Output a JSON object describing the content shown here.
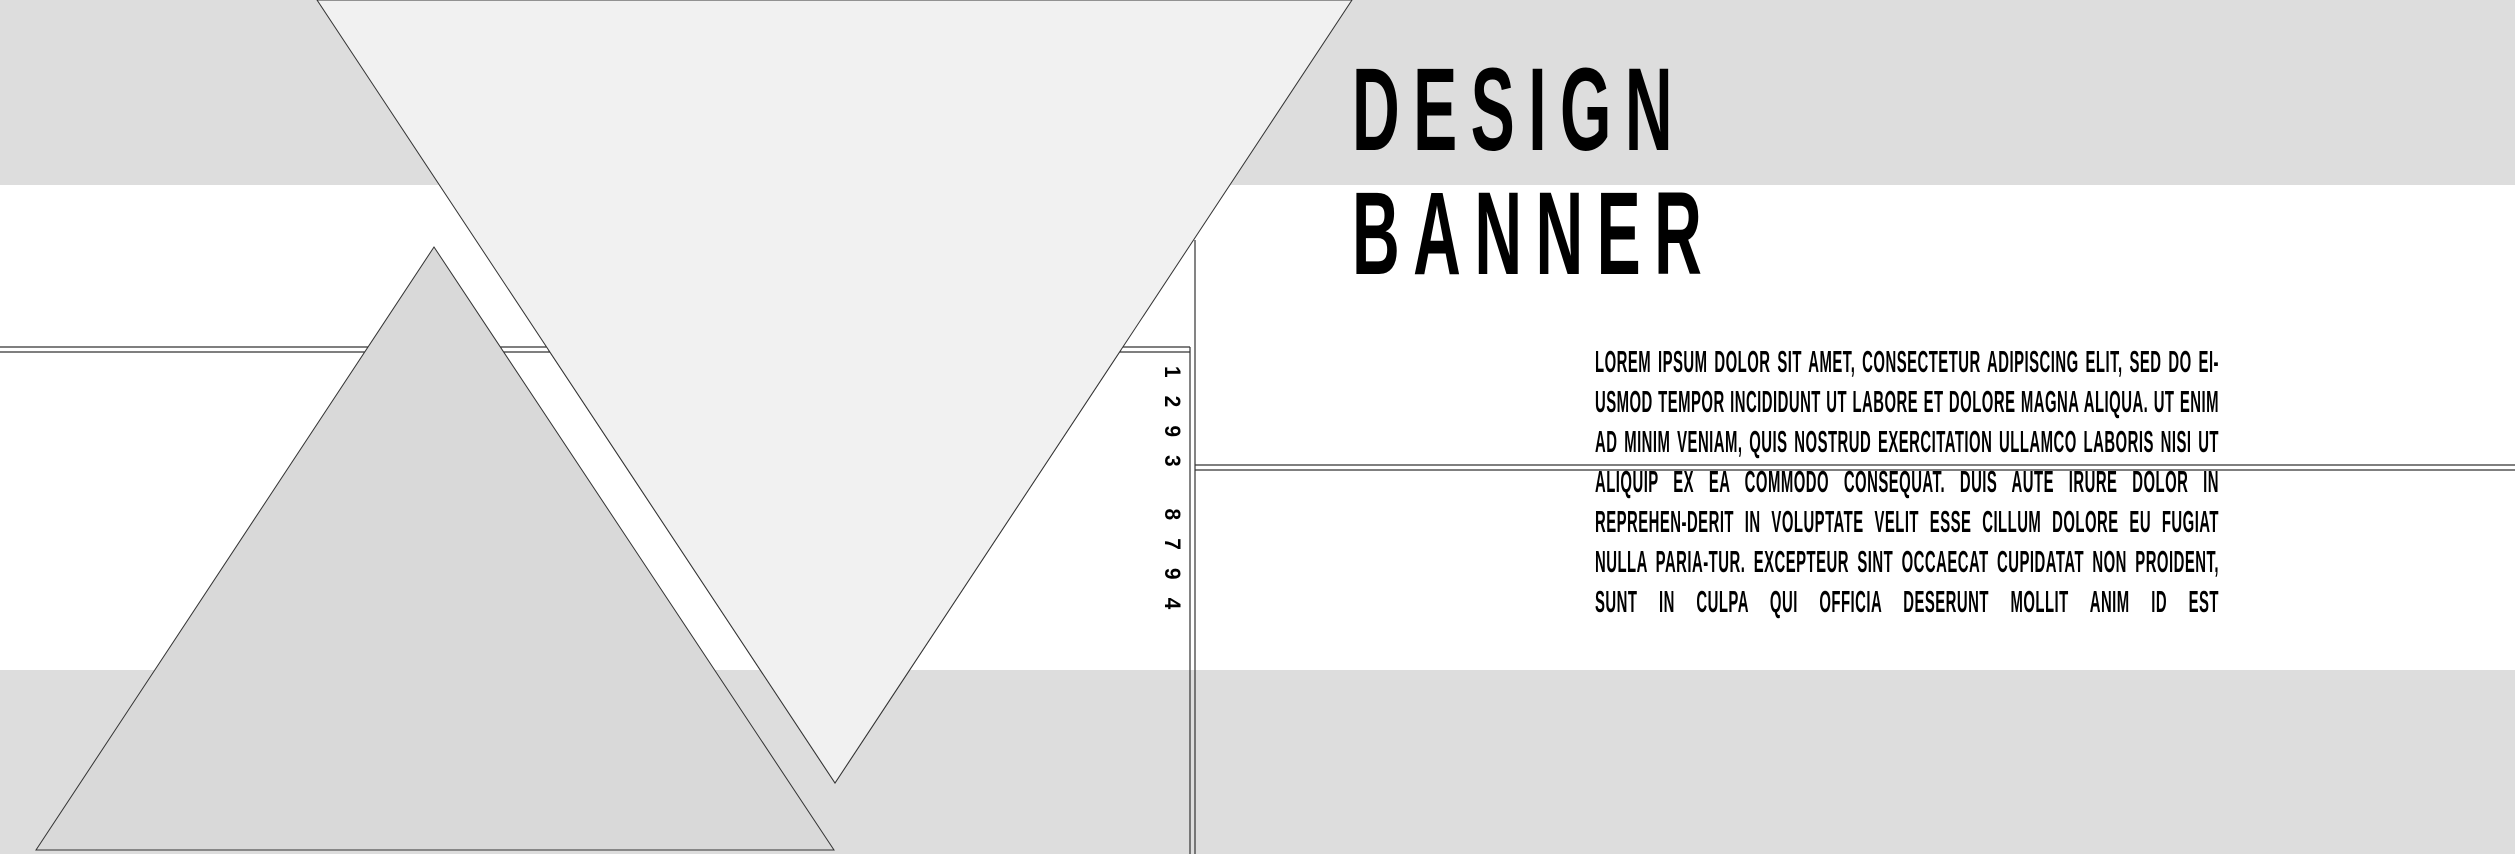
{
  "banner": {
    "title_line1": "DESIGN",
    "title_line2": "BANNER",
    "body": "LOREM IPSUM DOLOR SIT AMET, CONSECTETUR ADIPISCING ELIT, SED DO EI-USMOD TEMPOR INCIDIDUNT UT LABORE ET DOLORE MAGNA ALIQUA. UT ENIM AD MINIM VENIAM, QUIS NOSTRUD EXERCITATION ULLAMCO LABORIS NISI UT ALIQUIP EX EA COMMODO CONSEQUAT. DUIS AUTE IRURE DOLOR IN REPREHEN-DERIT IN VOLUPTATE VELIT ESSE CILLUM DOLORE EU FUGIAT NULLA PARIA-TUR. EXCEPTEUR SINT OCCAECAT CUPIDATAT NON PROIDENT, SUNT IN CULPA QUI OFFICIA DESERUNT MOLLIT ANIM ID EST",
    "serial_number": "1293 8794"
  },
  "colors": {
    "band_gray": "#dddddd",
    "light_triangle": "#f1f1f1",
    "dark_triangle": "#d9d9d9",
    "text": "#000000",
    "outline": "#333333"
  }
}
